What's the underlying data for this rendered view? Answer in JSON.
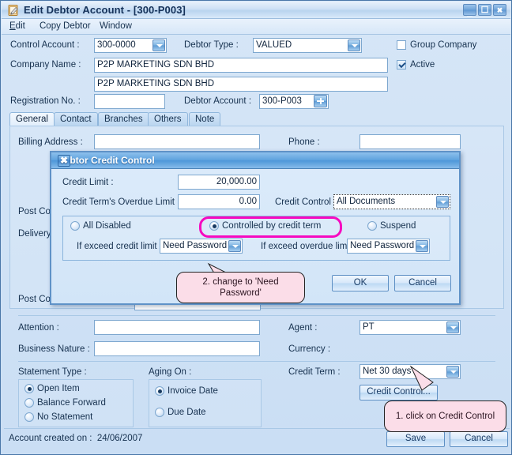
{
  "window": {
    "title": "Edit Debtor Account - [300-P003]",
    "icon": "edit-document-icon",
    "buttons": {
      "minimize": "_",
      "maximize": "❐",
      "close": "✖"
    }
  },
  "menu": {
    "items": [
      {
        "label": "Edit",
        "accel": "E"
      },
      {
        "label": "Copy Debtor"
      },
      {
        "label": "Window"
      }
    ]
  },
  "form": {
    "control_account_label": "Control Account :",
    "control_account_value": "300-0000",
    "debtor_type_label": "Debtor Type :",
    "debtor_type_value": "VALUED",
    "group_company_label": "Group Company",
    "group_company_checked": false,
    "active_label": "Active",
    "active_checked": true,
    "company_name_label": "Company Name :",
    "company_name_value": "P2P MARKETING SDN BHD",
    "company_name_value2": "P2P MARKETING SDN BHD",
    "registration_no_label": "Registration No. :",
    "registration_no_value": "",
    "debtor_account_label": "Debtor Account :",
    "debtor_account_value": "300-P003",
    "add_button": "+"
  },
  "tabs": [
    {
      "label": "General",
      "selected": true
    },
    {
      "label": "Contact",
      "selected": false
    },
    {
      "label": "Branches",
      "selected": false
    },
    {
      "label": "Others",
      "selected": false
    },
    {
      "label": "Note",
      "selected": false
    }
  ],
  "general": {
    "billing_address_label": "Billing Address :",
    "billing_address_value": "",
    "phone_label": "Phone :",
    "phone_value": "",
    "post_code_label": "Post Cod",
    "delivery_label": "Delivery",
    "post_code_label2": "Post Cod",
    "attention_label": "Attention :",
    "attention_value": "",
    "business_nature_label": "Business Nature :",
    "business_nature_value": "",
    "agent_label": "Agent :",
    "agent_value": "PT",
    "currency_label": "Currency :",
    "statement_type_label": "Statement Type :",
    "statement_type_options": [
      "Open Item",
      "Balance Forward",
      "No Statement"
    ],
    "statement_type_selected": "Open Item",
    "aging_on_label": "Aging On :",
    "aging_on_options": [
      "Invoice Date",
      "Due Date"
    ],
    "aging_on_selected": "Invoice Date",
    "credit_term_label": "Credit Term :",
    "credit_term_value": "Net 30 days",
    "credit_control_button": "Credit Control..."
  },
  "status": {
    "account_created_label": "Account created on :",
    "account_created_date": "24/06/2007",
    "save_button": "Save",
    "cancel_button": "Cancel"
  },
  "dialog": {
    "title": "Debtor Credit Control",
    "close": "✖",
    "credit_limit_label": "Credit Limit :",
    "credit_limit_value": "20,000.00",
    "overdue_limit_label": "Credit Term's Overdue Limit",
    "overdue_limit_value": "0.00",
    "credit_control_label": "Credit Control",
    "credit_control_value": "All Documents",
    "modes": [
      {
        "label": "All Disabled",
        "selected": false
      },
      {
        "label": "Controlled by credit term",
        "selected": true
      },
      {
        "label": "Suspend",
        "selected": false
      }
    ],
    "exceed_credit_limit_label": "If exceed credit limit",
    "exceed_credit_limit_value": "Need Password",
    "exceed_overdue_limit_label": "If exceed overdue limit",
    "exceed_overdue_limit_value": "Need Password",
    "ok_button": "OK",
    "cancel_button": "Cancel"
  },
  "annotations": {
    "callout1": "1. click on Credit Control",
    "callout2": "2. change to 'Need Password'",
    "highlight_color": "#f60ac0",
    "callout_fill": "#fbdde8"
  }
}
